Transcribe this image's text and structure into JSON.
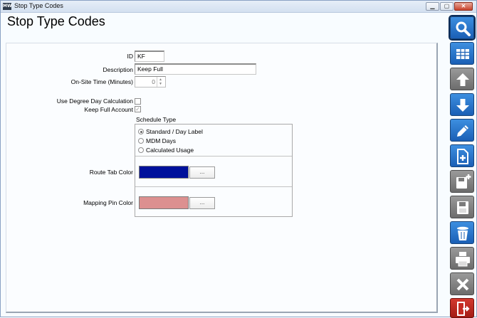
{
  "window": {
    "title": "Stop Type Codes",
    "app_icon_text": "MW"
  },
  "page": {
    "title": "Stop Type Codes"
  },
  "form": {
    "id_label": "ID",
    "id_value": "KF",
    "description_label": "Description",
    "description_value": "Keep Full",
    "onsite_label": "On-Site Time (Minutes)",
    "onsite_value": "0",
    "degree_day_label": "Use Degree Day Calculation",
    "degree_day_checked": false,
    "keep_full_label": "Keep Full  Account",
    "keep_full_checked": true,
    "schedule_type_label": "Schedule Type",
    "schedule_options": [
      {
        "label": "Standard / Day Label",
        "selected": true
      },
      {
        "label": "MDM Days",
        "selected": false
      },
      {
        "label": "Calculated Usage",
        "selected": false
      }
    ],
    "route_tab_color_label": "Route Tab Color",
    "route_tab_color": "#00109b",
    "mapping_pin_color_label": "Mapping Pin Color",
    "mapping_pin_color": "#dc9090",
    "ellipsis_label": "..."
  },
  "toolbar": [
    {
      "name": "search-icon",
      "style": "blue"
    },
    {
      "name": "grid-icon",
      "style": "blue"
    },
    {
      "name": "arrow-up-icon",
      "style": "gray"
    },
    {
      "name": "arrow-down-icon",
      "style": "blue"
    },
    {
      "name": "pencil-icon",
      "style": "blue"
    },
    {
      "name": "new-document-icon",
      "style": "blue"
    },
    {
      "name": "save-new-icon",
      "style": "gray"
    },
    {
      "name": "save-icon",
      "style": "gray"
    },
    {
      "name": "trash-icon",
      "style": "blue"
    },
    {
      "name": "print-icon",
      "style": "gray"
    },
    {
      "name": "close-x-icon",
      "style": "gray"
    },
    {
      "name": "exit-door-icon",
      "style": "red"
    }
  ]
}
